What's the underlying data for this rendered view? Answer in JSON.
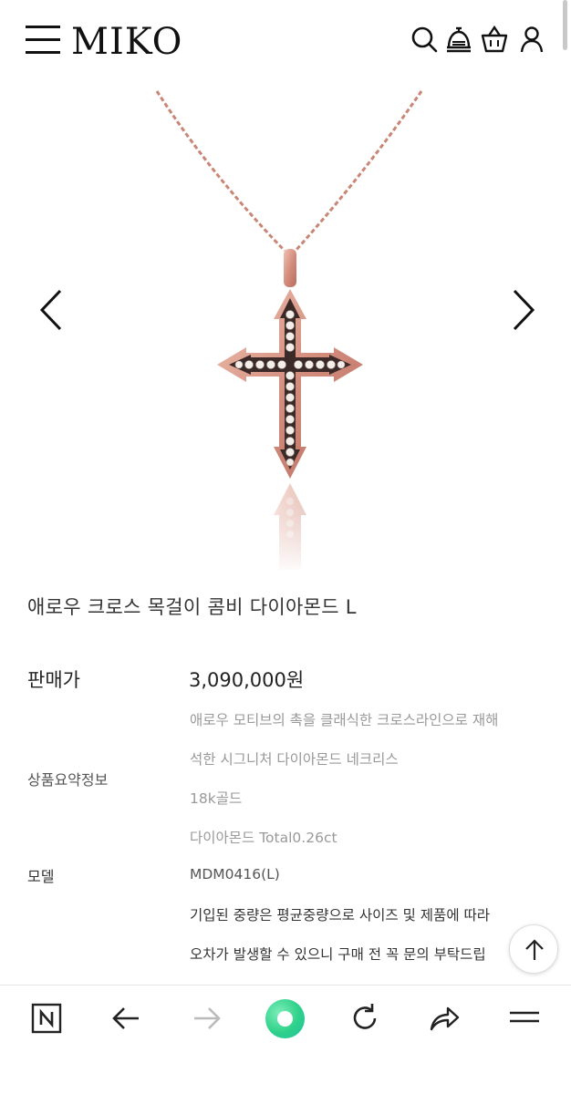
{
  "header": {
    "logo": "MIKO",
    "icons": [
      "menu-icon",
      "search-icon",
      "bell-icon",
      "basket-icon",
      "user-icon"
    ]
  },
  "product": {
    "image_alt": "rose gold arrow cross necklace with diamonds",
    "title": "애로우 크로스 목걸이 콤비 다이아몬드 L",
    "price_label": "판매가",
    "price": "3,090,000원",
    "summary_label": "상품요약정보",
    "summary_lines": [
      "애로우 모티브의 촉을 클래식한 크로스라인으로 재해",
      "석한 시그니처 다이아몬드 네크리스",
      "18k골드",
      "다이아몬드 Total0.26ct"
    ],
    "model_label": "모델",
    "model": "MDM0416(L)",
    "note_lines": [
      "기입된 중량은 평균중량으로 사이즈 및 제품에 따라",
      "오차가 발생할 수 있으니 구매 전 꼭 문의 부탁드립"
    ]
  },
  "colors": {
    "rose_gold": "#d9988a",
    "accent_green": "#2ed18a"
  },
  "browser_bar": {
    "icons": [
      "naver-n-icon",
      "back-arrow-icon",
      "forward-arrow-icon",
      "green-home-dot",
      "refresh-icon",
      "share-icon",
      "hamburger-icon"
    ]
  }
}
